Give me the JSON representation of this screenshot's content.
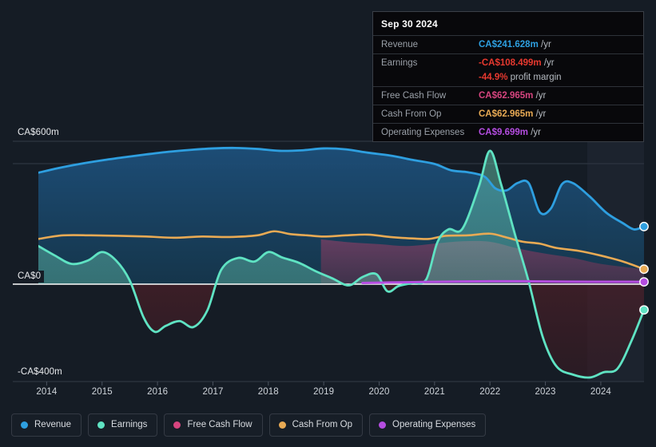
{
  "chart_data": {
    "type": "area",
    "title": "",
    "xlabel": "",
    "ylabel": "",
    "currency": "CA$",
    "grid": true,
    "legend_position": "bottom",
    "ylim": [
      -400,
      600
    ],
    "ytick_labels": [
      "CA$600m",
      "CA$0",
      "-CA$400m"
    ],
    "ytick_values": [
      600,
      0,
      -400
    ],
    "xlim": [
      2013.6,
      2024.9
    ],
    "xtick_labels": [
      "2014",
      "2015",
      "2016",
      "2017",
      "2018",
      "2019",
      "2020",
      "2021",
      "2022",
      "2023",
      "2024"
    ],
    "xtick_values": [
      2014,
      2015,
      2016,
      2017,
      2018,
      2019,
      2020,
      2021,
      2022,
      2023,
      2024
    ],
    "series": [
      {
        "name": "Revenue",
        "color": "#2e9fe0",
        "x": [
          2013.85,
          2014.2,
          2014.6,
          2015.0,
          2015.4,
          2015.8,
          2016.2,
          2016.6,
          2017.0,
          2017.4,
          2017.8,
          2018.2,
          2018.6,
          2019.0,
          2019.4,
          2019.8,
          2020.2,
          2020.6,
          2021.0,
          2021.3,
          2021.6,
          2021.9,
          2022.1,
          2022.3,
          2022.5,
          2022.7,
          2022.9,
          2023.1,
          2023.3,
          2023.5,
          2023.8,
          2024.1,
          2024.4,
          2024.6,
          2024.78
        ],
        "values": [
          468,
          487,
          505,
          520,
          533,
          545,
          556,
          564,
          570,
          572,
          568,
          560,
          562,
          570,
          566,
          552,
          540,
          522,
          505,
          478,
          470,
          452,
          402,
          394,
          425,
          424,
          302,
          318,
          420,
          424,
          368,
          300,
          256,
          230,
          242
        ]
      },
      {
        "name": "Earnings",
        "color": "#5fe3c3",
        "x": [
          2013.85,
          2014.15,
          2014.45,
          2014.75,
          2015.0,
          2015.25,
          2015.5,
          2015.75,
          2015.95,
          2016.15,
          2016.4,
          2016.65,
          2016.9,
          2017.15,
          2017.45,
          2017.75,
          2018.0,
          2018.25,
          2018.55,
          2018.85,
          2019.15,
          2019.45,
          2019.7,
          2019.95,
          2020.15,
          2020.35,
          2020.6,
          2020.85,
          2021.05,
          2021.25,
          2021.5,
          2021.8,
          2022.0,
          2022.2,
          2022.45,
          2022.7,
          2022.95,
          2023.2,
          2023.5,
          2023.8,
          2024.05,
          2024.3,
          2024.55,
          2024.78
        ],
        "values": [
          160,
          120,
          85,
          100,
          135,
          100,
          15,
          -140,
          -200,
          -175,
          -155,
          -180,
          -110,
          60,
          110,
          95,
          135,
          112,
          90,
          55,
          25,
          -5,
          30,
          42,
          -30,
          -8,
          5,
          20,
          175,
          230,
          232,
          410,
          560,
          420,
          210,
          10,
          -220,
          -345,
          -380,
          -392,
          -370,
          -355,
          -240,
          -108
        ]
      },
      {
        "name": "Free Cash Flow",
        "color": "#d6457f",
        "x": [
          2018.95,
          2019.5,
          2020.0,
          2020.5,
          2021.0,
          2021.5,
          2022.0,
          2022.5,
          2023.0,
          2023.5,
          2024.0,
          2024.78
        ],
        "values": [
          188,
          175,
          168,
          160,
          170,
          180,
          178,
          150,
          128,
          110,
          85,
          63
        ]
      },
      {
        "name": "Cash From Op",
        "color": "#e8aa54",
        "x": [
          2013.85,
          2014.3,
          2014.8,
          2015.3,
          2015.8,
          2016.3,
          2016.8,
          2017.3,
          2017.8,
          2018.1,
          2018.4,
          2018.7,
          2019.0,
          2019.4,
          2019.8,
          2020.2,
          2020.6,
          2020.9,
          2021.2,
          2021.6,
          2022.0,
          2022.3,
          2022.6,
          2022.9,
          2023.2,
          2023.6,
          2024.0,
          2024.4,
          2024.78
        ],
        "values": [
          190,
          205,
          205,
          203,
          200,
          195,
          200,
          198,
          205,
          222,
          210,
          205,
          200,
          205,
          208,
          198,
          192,
          190,
          203,
          205,
          212,
          196,
          178,
          170,
          152,
          140,
          120,
          95,
          63
        ]
      },
      {
        "name": "Operating Expenses",
        "color": "#b44de0",
        "x": [
          2019.7,
          2020.2,
          2020.8,
          2021.4,
          2022.0,
          2022.6,
          2023.2,
          2023.8,
          2024.3,
          2024.78
        ],
        "values": [
          5,
          7,
          9,
          11,
          12,
          12,
          11,
          10,
          10,
          9.7
        ]
      }
    ]
  },
  "tooltip": {
    "title": "Sep 30 2024",
    "rows": [
      {
        "label": "Revenue",
        "amount": "CA$241.628m",
        "unit": "/yr",
        "color": "#2e9fe0"
      },
      {
        "label": "Earnings",
        "amount": "-CA$108.499m",
        "unit": "/yr",
        "color": "#e8392f"
      },
      {
        "label": "",
        "amount": "-44.9%",
        "unit": "profit margin",
        "color": "#e8392f"
      },
      {
        "label": "Free Cash Flow",
        "amount": "CA$62.965m",
        "unit": "/yr",
        "color": "#d6457f"
      },
      {
        "label": "Cash From Op",
        "amount": "CA$62.965m",
        "unit": "/yr",
        "color": "#e8aa54"
      },
      {
        "label": "Operating Expenses",
        "amount": "CA$9.699m",
        "unit": "/yr",
        "color": "#b44de0"
      }
    ]
  },
  "legend": {
    "items": [
      {
        "label": "Revenue",
        "color": "#2e9fe0"
      },
      {
        "label": "Earnings",
        "color": "#5fe3c3"
      },
      {
        "label": "Free Cash Flow",
        "color": "#d6457f"
      },
      {
        "label": "Cash From Op",
        "color": "#e8aa54"
      },
      {
        "label": "Operating Expenses",
        "color": "#b44de0"
      }
    ]
  }
}
